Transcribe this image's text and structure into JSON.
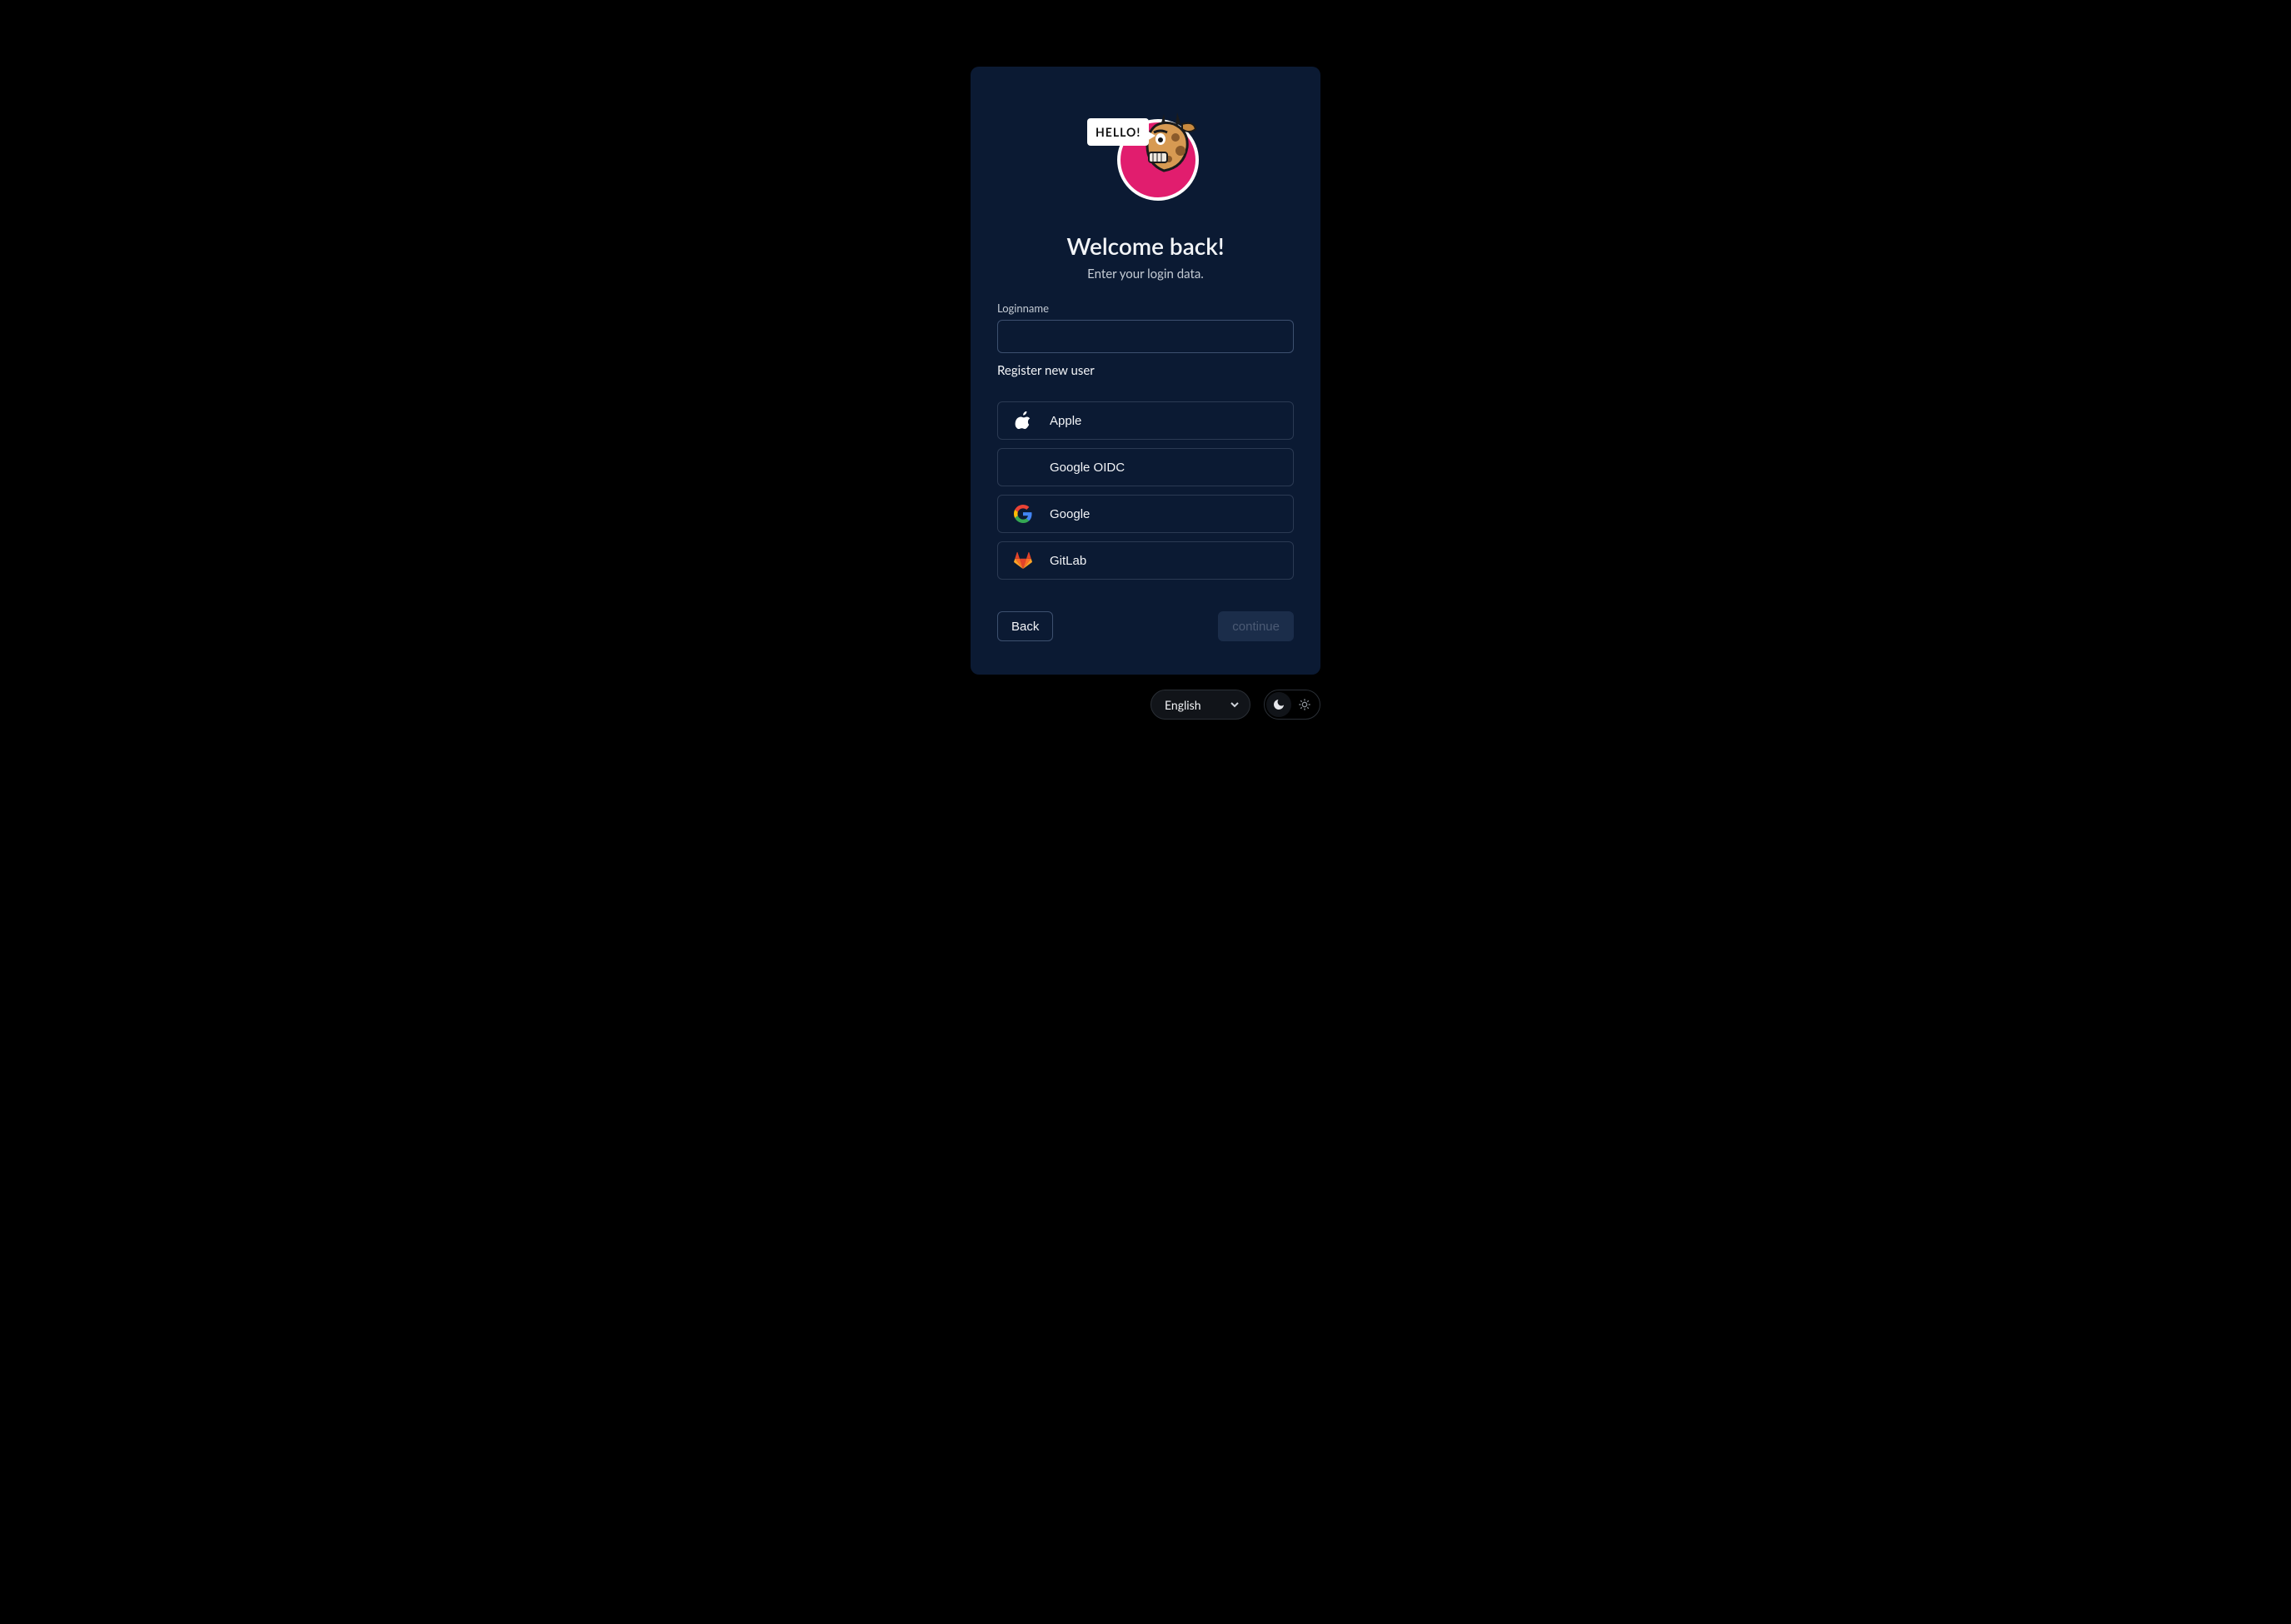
{
  "logo": {
    "speech_text": "HELLO!"
  },
  "headings": {
    "title": "Welcome back!",
    "subtitle": "Enter your login data."
  },
  "form": {
    "login_label": "Loginname",
    "login_value": "",
    "register_link": "Register new user"
  },
  "providers": [
    {
      "id": "apple",
      "label": "Apple",
      "icon": "apple-icon"
    },
    {
      "id": "google-oidc",
      "label": "Google OIDC",
      "icon": null
    },
    {
      "id": "google",
      "label": "Google",
      "icon": "google-icon"
    },
    {
      "id": "gitlab",
      "label": "GitLab",
      "icon": "gitlab-icon"
    }
  ],
  "actions": {
    "back_label": "Back",
    "continue_label": "continue",
    "continue_enabled": false
  },
  "footer": {
    "language_selected": "English",
    "theme": "dark"
  },
  "colors": {
    "accent": "#e11d6e",
    "card_bg": "#0b1a33"
  }
}
